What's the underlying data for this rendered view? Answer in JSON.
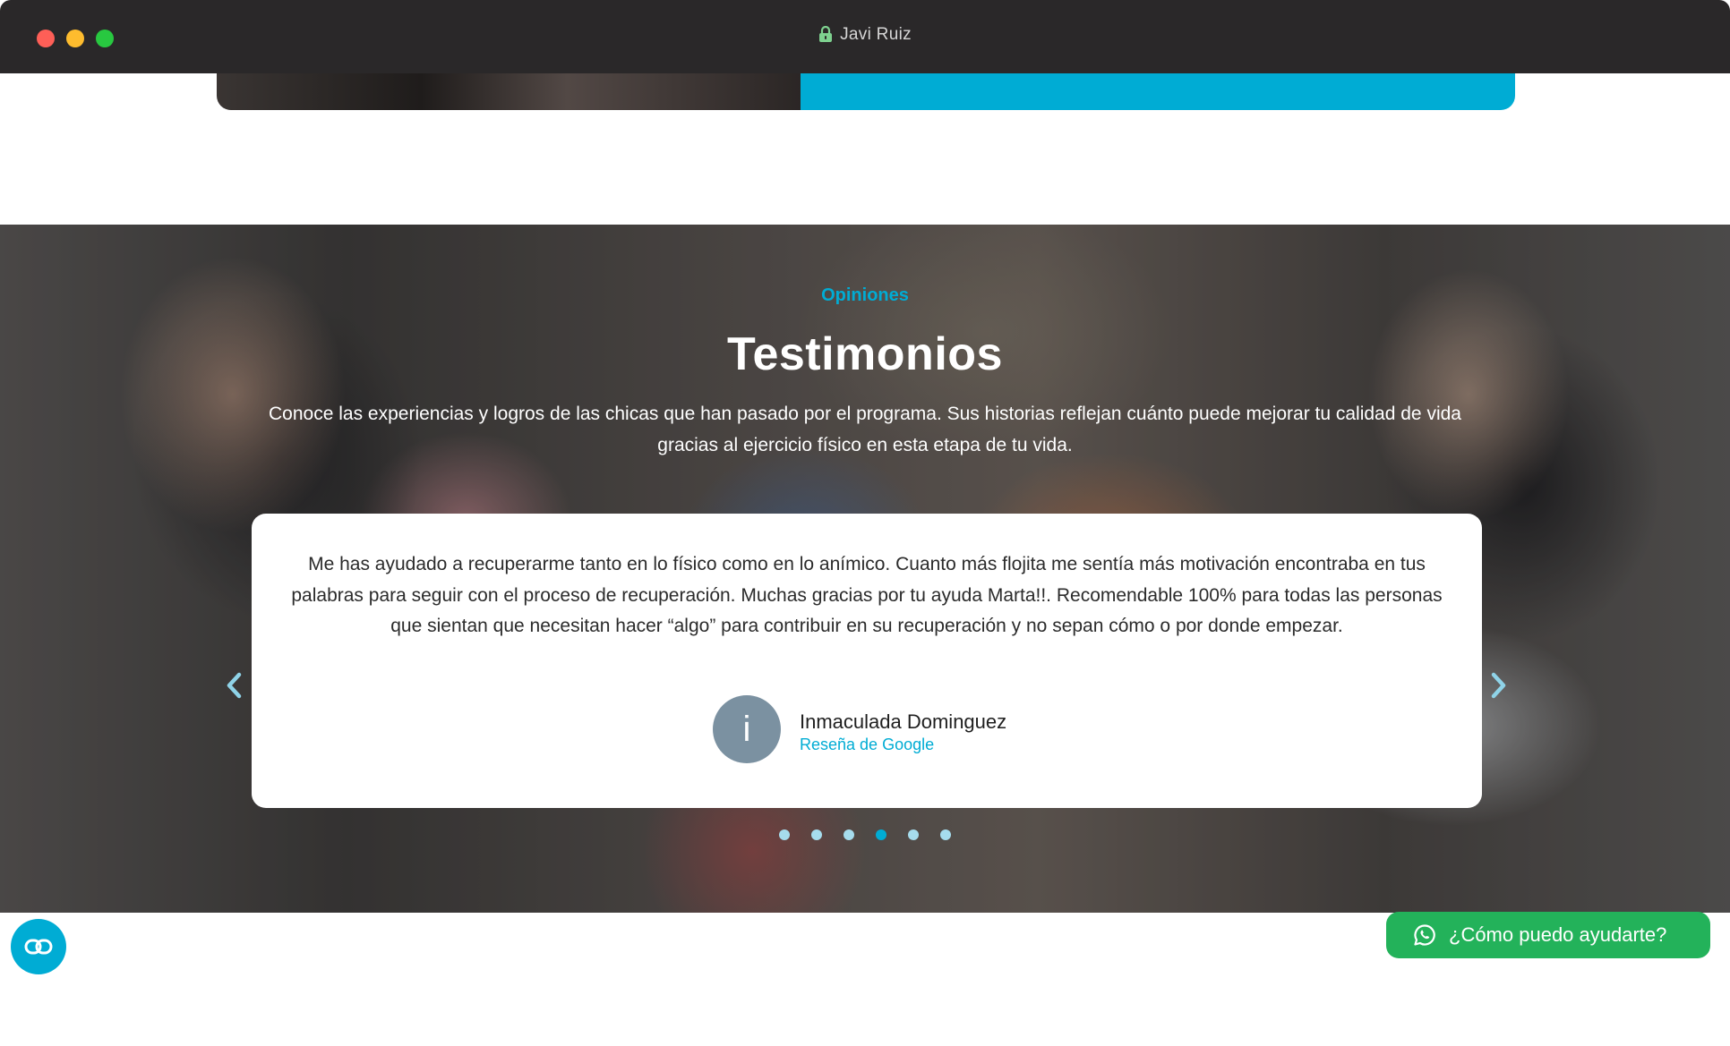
{
  "browser": {
    "site_title": "Javi Ruiz"
  },
  "testimonials": {
    "eyebrow": "Opiniones",
    "title": "Testimonios",
    "description": "Conoce las experiencias y logros de las chicas que han pasado por el programa.  Sus historias reflejan cuánto puede mejorar tu calidad de vida gracias al ejercicio físico en esta etapa de tu vida.",
    "review": {
      "text": "Me has ayudado a recuperarme tanto en lo físico como en lo anímico. Cuanto más flojita me sentía más motivación encontraba en tus palabras para seguir con el proceso de recuperación. Muchas gracias por tu ayuda Marta!!. Recomendable 100% para todas las personas que sientan que necesitan hacer “algo” para contribuir en su recuperación y no sepan cómo o por donde empezar.",
      "avatar_initial": "i",
      "author": "Inmaculada Dominguez",
      "source": "Reseña de Google"
    },
    "pager": {
      "total": 6,
      "active_index": 3
    }
  },
  "widgets": {
    "whatsapp_label": "¿Cómo puedo ayudarte?"
  },
  "colors": {
    "accent": "#00acd4",
    "whatsapp": "#23b25a",
    "titlebar": "#2a2829",
    "avatar": "#7b91a1"
  },
  "icons": [
    "lock-icon",
    "chevron-left-icon",
    "chevron-right-icon",
    "accessibility-icon",
    "whatsapp-icon"
  ]
}
